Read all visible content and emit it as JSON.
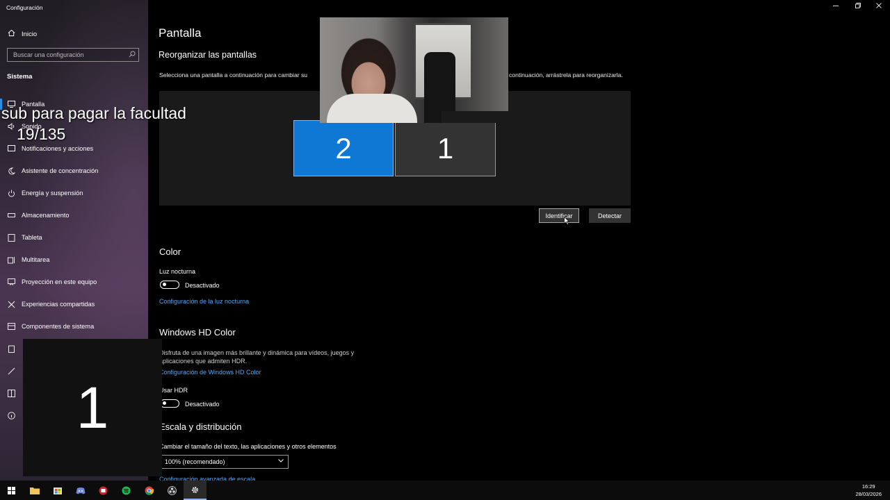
{
  "window": {
    "title": "Configuración"
  },
  "sidebar": {
    "home_label": "Inicio",
    "search_placeholder": "Buscar una configuración",
    "section_label": "Sistema",
    "items": [
      {
        "label": "Pantalla",
        "icon": "monitor-icon"
      },
      {
        "label": "Sonido",
        "icon": "speaker-icon"
      },
      {
        "label": "Notificaciones y acciones",
        "icon": "notification-icon"
      },
      {
        "label": "Asistente de concentración",
        "icon": "moon-icon"
      },
      {
        "label": "Energía y suspensión",
        "icon": "power-icon"
      },
      {
        "label": "Almacenamiento",
        "icon": "storage-icon"
      },
      {
        "label": "Tableta",
        "icon": "tablet-icon"
      },
      {
        "label": "Multitarea",
        "icon": "multitask-icon"
      },
      {
        "label": "Proyección en este equipo",
        "icon": "projection-icon"
      },
      {
        "label": "Experiencias compartidas",
        "icon": "shared-icon"
      },
      {
        "label": "Componentes de sistema",
        "icon": "components-icon"
      }
    ]
  },
  "main": {
    "title": "Pantalla",
    "arrange_heading": "Reorganizar las pantallas",
    "arrange_desc_left": "Selecciona una pantalla a continuación para cambiar su",
    "arrange_desc_right": "continuación, arrástrela para reorganizarla.",
    "monitor_a": "2",
    "monitor_b": "1",
    "identify_button": "Identificar",
    "detect_button": "Detectar",
    "color_heading": "Color",
    "night_light_label": "Luz nocturna",
    "night_light_state": "Desactivado",
    "night_light_link": "Configuración de la luz nocturna",
    "hd_heading": "Windows HD Color",
    "hd_desc_1": "Disfruta de una imagen más brillante y dinámica para vídeos, juegos y",
    "hd_desc_2": "aplicaciones que admiten HDR.",
    "hd_link": "Configuración de Windows HD Color",
    "hdr_label": "Usar HDR",
    "hdr_state": "Desactivado",
    "scale_heading": "Escala y distribución",
    "scale_desc": "Cambiar el tamaño del texto, las aplicaciones y otros elementos",
    "scale_value": "100% (recomendado)",
    "scale_link": "Configuración avanzada de escala"
  },
  "overlay": {
    "caption": "sub para pagar la facultad",
    "counter": "19/135",
    "identify_number": "1"
  },
  "taskbar": {
    "time": "16:29",
    "date": "28/03/2026",
    "icons": [
      "windows-start-icon",
      "file-explorer-icon",
      "store-icon",
      "discord-icon",
      "app-red-icon",
      "spotify-icon",
      "chrome-icon",
      "obs-icon",
      "settings-icon"
    ]
  },
  "colors": {
    "accent": "#0f78d4",
    "link": "#5aa6ee"
  }
}
